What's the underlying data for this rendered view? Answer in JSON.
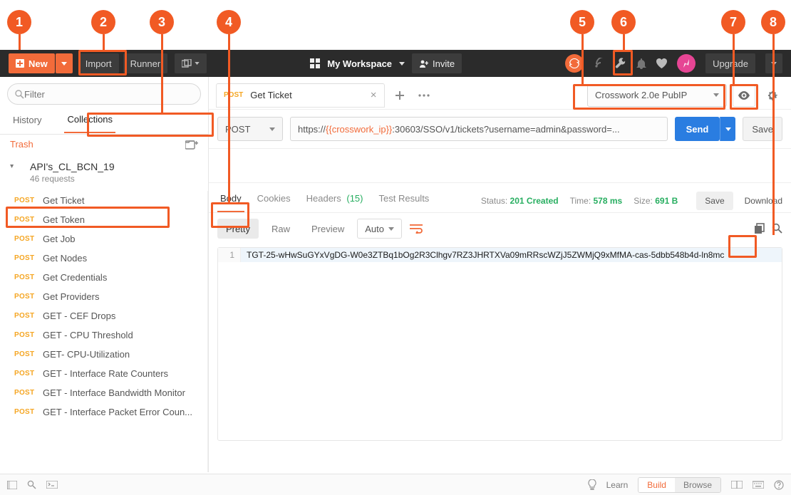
{
  "callouts": [
    "1",
    "2",
    "3",
    "4",
    "5",
    "6",
    "7",
    "8"
  ],
  "topbar": {
    "new_label": "New",
    "import_label": "Import",
    "runner_label": "Runner",
    "workspace_label": "My Workspace",
    "invite_label": "Invite",
    "upgrade_label": "Upgrade"
  },
  "sidebar": {
    "filter_placeholder": "Filter",
    "tab_history": "History",
    "tab_collections": "Collections",
    "trash_label": "Trash",
    "collection": {
      "name": "API's_CL_BCN_19",
      "sub": "46 requests"
    },
    "requests": [
      {
        "method": "POST",
        "name": "Get Ticket"
      },
      {
        "method": "POST",
        "name": "Get Token"
      },
      {
        "method": "POST",
        "name": "Get Job"
      },
      {
        "method": "POST",
        "name": "Get Nodes"
      },
      {
        "method": "POST",
        "name": "Get Credentials"
      },
      {
        "method": "POST",
        "name": "Get Providers"
      },
      {
        "method": "POST",
        "name": "GET - CEF Drops"
      },
      {
        "method": "POST",
        "name": "GET - CPU Threshold"
      },
      {
        "method": "POST",
        "name": "GET- CPU-Utilization"
      },
      {
        "method": "POST",
        "name": "GET - Interface Rate Counters"
      },
      {
        "method": "POST",
        "name": "GET - Interface Bandwidth Monitor"
      },
      {
        "method": "POST",
        "name": "GET - Interface Packet Error Coun..."
      }
    ]
  },
  "main": {
    "tab_name": "Get Ticket",
    "tab_method": "POST",
    "env_name": "Crosswork 2.0e PubIP",
    "method": "POST",
    "url_prefix": "https://",
    "url_var": "{{crosswork_ip}}",
    "url_rest": ":30603/SSO/v1/tickets?username=admin&password=...",
    "send_label": "Send",
    "save_label": "Save",
    "resp_tabs": {
      "body": "Body",
      "cookies": "Cookies",
      "headers": "Headers",
      "headers_count": "(15)",
      "tests": "Test Results"
    },
    "status_label": "Status:",
    "status_value": "201 Created",
    "time_label": "Time:",
    "time_value": "578 ms",
    "size_label": "Size:",
    "size_value": "691 B",
    "mini_save": "Save",
    "download": "Download",
    "view_pretty": "Pretty",
    "view_raw": "Raw",
    "view_preview": "Preview",
    "view_auto": "Auto",
    "code_line_num": "1",
    "code_text": "TGT-25-wHwSuGYxVgDG-W0e3ZTBq1bOg2R3Clhgv7RZ3JHRTXVa09mRRscWZjJ5ZWMjQ9xMfMA-cas-5dbb548b4d-ln8mc"
  },
  "statusbar": {
    "learn": "Learn",
    "build": "Build",
    "browse": "Browse"
  }
}
